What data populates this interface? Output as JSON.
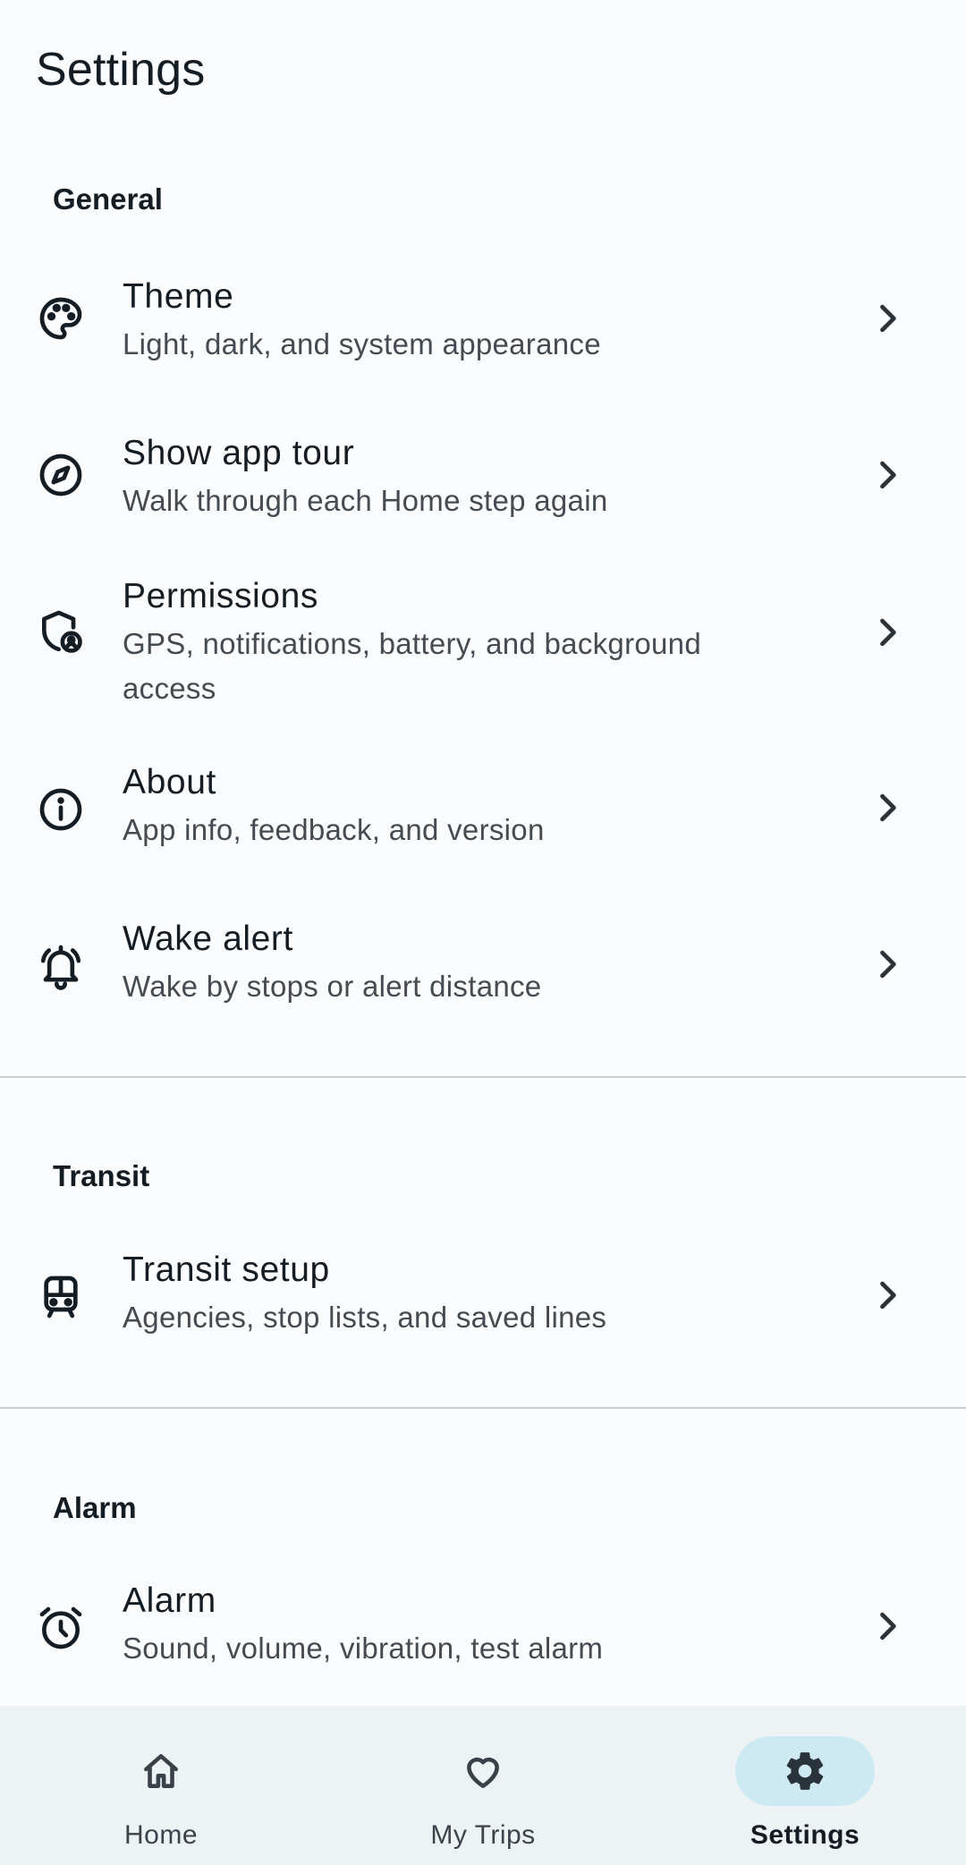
{
  "page": {
    "title": "Settings"
  },
  "sections": {
    "general": "General",
    "transit": "Transit",
    "alarm": "Alarm"
  },
  "items": {
    "theme": {
      "title": "Theme",
      "subtitle": "Light, dark, and system appearance",
      "icon": "palette-icon"
    },
    "app_tour": {
      "title": "Show app tour",
      "subtitle": "Walk through each Home step again",
      "icon": "compass-icon"
    },
    "permissions": {
      "title": "Permissions",
      "subtitle": "GPS, notifications, battery, and background access",
      "icon": "shield-person-icon"
    },
    "about": {
      "title": "About",
      "subtitle": "App info, feedback, and version",
      "icon": "info-icon"
    },
    "wake_alert": {
      "title": "Wake alert",
      "subtitle": "Wake by stops or alert distance",
      "icon": "bell-ringing-icon"
    },
    "transit_setup": {
      "title": "Transit setup",
      "subtitle": "Agencies, stop lists, and saved lines",
      "icon": "train-icon"
    },
    "alarm": {
      "title": "Alarm",
      "subtitle": "Sound, volume, vibration, test alarm",
      "icon": "alarm-clock-icon"
    }
  },
  "bottom_nav": {
    "items": [
      {
        "label": "Home",
        "icon": "home-icon",
        "active": false
      },
      {
        "label": "My Trips",
        "icon": "heart-icon",
        "active": false
      },
      {
        "label": "Settings",
        "icon": "gear-icon",
        "active": true
      }
    ]
  },
  "colors": {
    "background": "#fafcfd",
    "text_primary": "#141c24",
    "text_secondary": "#444b52",
    "divider": "#c9ced3",
    "nav_background": "#edf2f5",
    "nav_active_pill": "#cdeaf3"
  }
}
